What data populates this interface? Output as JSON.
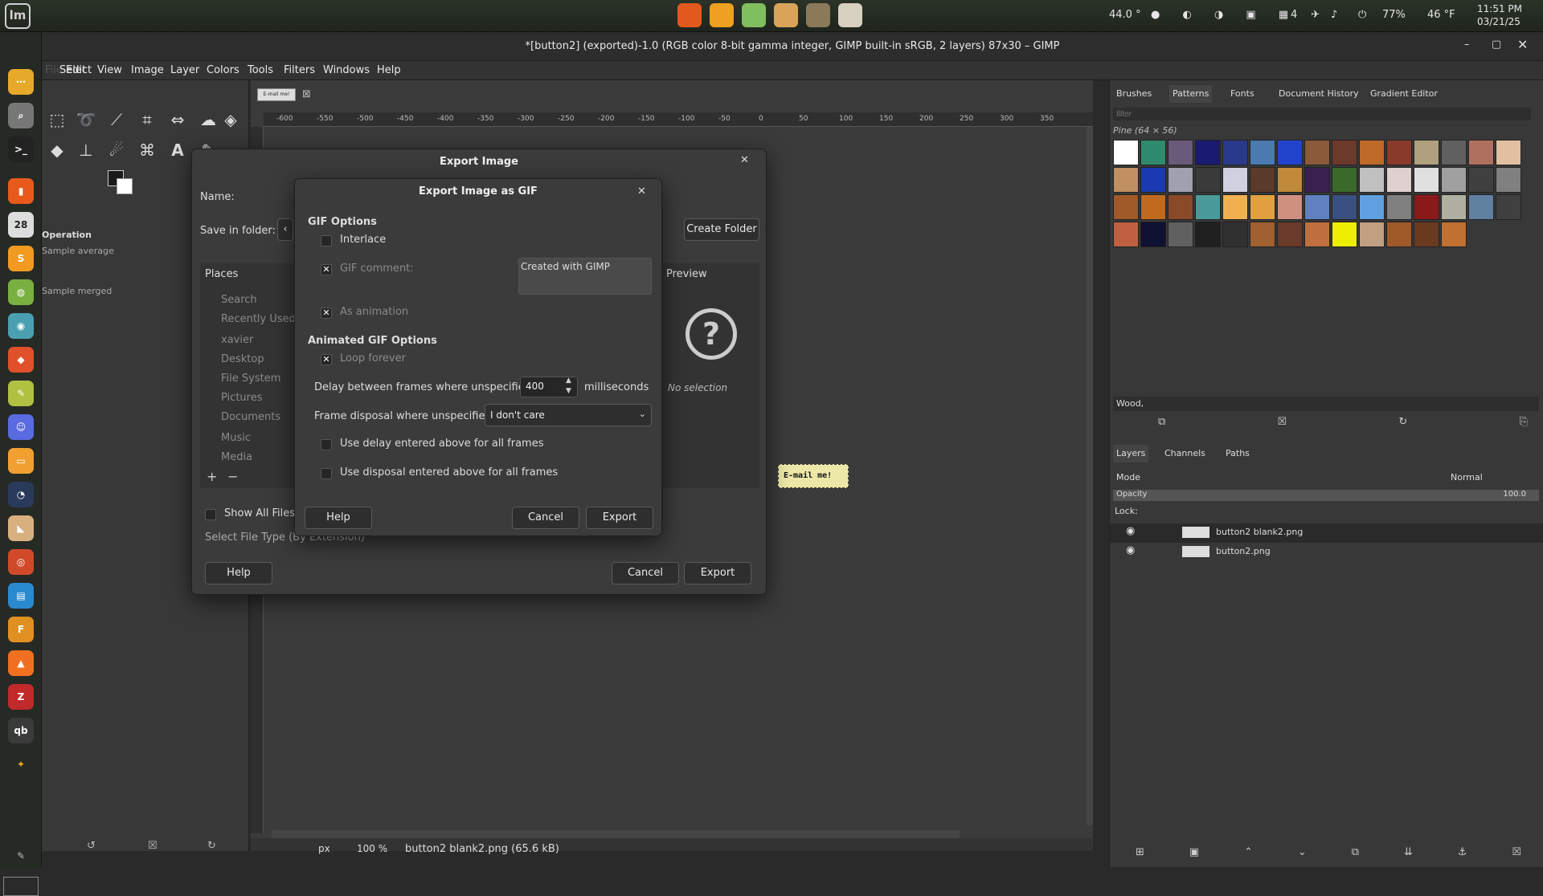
{
  "topbar": {
    "temp_cpu": "44.0 °",
    "battery": "77%",
    "weather": "46 °F",
    "time": "11:51 PM",
    "date": "03/21/25",
    "notif_count": "4"
  },
  "window": {
    "title": "*[button2] (exported)-1.0 (RGB color 8-bit gamma integer, GIMP built-in sRGB, 2 layers) 87x30 – GIMP"
  },
  "menubar": [
    "Edit",
    "Select",
    "View",
    "Image",
    "Layer",
    "Colors",
    "Tools",
    "Filters",
    "Windows",
    "Help"
  ],
  "menubar_file": "File",
  "toolbox": {
    "operation_label": "Operation",
    "sample_average": "Sample average",
    "sample_merged": "Sample merged"
  },
  "canvas": {
    "image_tab_text": "E-mail me!",
    "button_text": "E-mail me!",
    "ruler_labels": [
      "-600",
      "-550",
      "-500",
      "-450",
      "-400",
      "-350",
      "-300",
      "-250",
      "-200",
      "-150",
      "-100",
      "-50",
      "0",
      "50",
      "100",
      "150",
      "200",
      "250",
      "300",
      "350"
    ],
    "status_unit": "px",
    "status_zoom": "100 %",
    "status_file": "button2 blank2.png (65.6 kB)"
  },
  "right_dock": {
    "tabs": [
      "Brushes",
      "Patterns",
      "Fonts",
      "Document History",
      "Gradient Editor"
    ],
    "filter_placeholder": "filter",
    "pattern_name": "Pine (64 × 56)",
    "pattern_tag": "Wood,",
    "layer_tabs": [
      "Layers",
      "Channels",
      "Paths"
    ],
    "mode_label": "Mode",
    "mode_value": "Normal",
    "opacity_label": "Opacity",
    "opacity_value": "100.0",
    "lock_label": "Lock:",
    "layers": [
      {
        "name": "button2 blank2.png"
      },
      {
        "name": "button2.png"
      }
    ],
    "pattern_colors": [
      "#ffffff",
      "#2e8b6e",
      "#6a5a7a",
      "#1a1a70",
      "#2a3a8a",
      "#4a7ab0",
      "#2244cc",
      "#8a5a3a",
      "#6b3a2a",
      "#c06a2a",
      "#8a3a2a",
      "#b0a080",
      "#606060",
      "#b07060",
      "#e0c0a0",
      "#c09060",
      "#1a3ab0",
      "#a0a0b0",
      "#3a3a3a",
      "#d0d0e0",
      "#5a3a2a",
      "#c08a3a",
      "#3a2050",
      "#3a6a2a",
      "#c0c0c0",
      "#e0d0d0",
      "#e0e0e0",
      "#a0a0a0",
      "#404040",
      "#808080",
      "#a05a2a",
      "#c06a20",
      "#8a4a2a",
      "#4a9a9a",
      "#f0b050",
      "#e0a040",
      "#d09080",
      "#6080c0",
      "#3a5080",
      "#60a0e0",
      "#808080",
      "#8a1a1a",
      "#b0b0a0",
      "#6080a0",
      "#404040",
      "#c06040",
      "#101030",
      "#606060",
      "#202020",
      "#303030",
      "#a06030",
      "#6a3a2a",
      "#c07040",
      "#eeee00",
      "#c0a080",
      "#a05a2a",
      "#6a3a20",
      "#c07030"
    ]
  },
  "export_dialog": {
    "title": "Export Image",
    "name_label": "Name:",
    "folder_label": "Save in folder:",
    "create_folder": "Create Folder",
    "places_header": "Places",
    "preview_header": "Preview",
    "places": [
      "Search",
      "Recently Used",
      "xavier",
      "Desktop",
      "File System",
      "Pictures",
      "Documents",
      "Music",
      "Media"
    ],
    "no_selection": "No selection",
    "show_all_files": "Show All Files",
    "select_file_type": "Select File Type (By Extension)",
    "help": "Help",
    "cancel": "Cancel",
    "export": "Export"
  },
  "gif_dialog": {
    "title": "Export Image as GIF",
    "gif_options": "GIF Options",
    "interlace": "Interlace",
    "gif_comment": "GIF comment:",
    "comment_value": "Created with GIMP",
    "as_animation": "As animation",
    "animated_options": "Animated GIF Options",
    "loop_forever": "Loop forever",
    "delay_label": "Delay between frames where unspecified:",
    "delay_value": "400",
    "milliseconds": "milliseconds",
    "disposal_label": "Frame disposal where unspecified:",
    "disposal_value": "I don't care",
    "use_delay_all": "Use delay entered above for all frames",
    "use_disposal_all": "Use disposal entered above for all frames",
    "help": "Help",
    "cancel": "Cancel",
    "export": "Export"
  }
}
